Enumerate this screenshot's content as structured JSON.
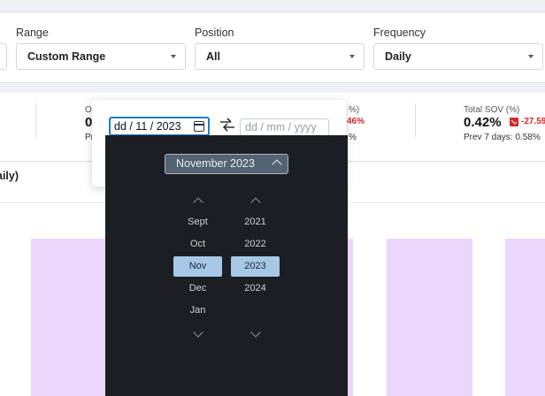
{
  "filters": {
    "range": {
      "label": "Range",
      "value": "Custom Range"
    },
    "position": {
      "label": "Position",
      "value": "All"
    },
    "frequency": {
      "label": "Frequency",
      "value": "Daily"
    }
  },
  "stats": {
    "partial_left": {
      "label_fragment": "O",
      "value_fragment": "0",
      "prev_fragment": "Pr"
    },
    "partial_mid": {
      "label_fragment": "%)",
      "delta_fragment": "46%",
      "prev_fragment": "%"
    },
    "total_sov": {
      "label": "Total SOV (%)",
      "value": "0.42%",
      "delta": "-27.59",
      "prev": "Prev 7 days: 0.58%"
    }
  },
  "chart": {
    "title_fragment": "aily)",
    "bar_color": "#ecd6fb"
  },
  "date_range": {
    "start_value": "dd / 11 / 2023",
    "end_placeholder": "dd / mm / yyyy"
  },
  "month_picker": {
    "header": "November 2023",
    "months": [
      "Sept",
      "Oct",
      "Nov",
      "Dec",
      "Jan"
    ],
    "years": [
      "2021",
      "2022",
      "2023",
      "2024"
    ],
    "selected_month": "Nov",
    "selected_year": "2023"
  },
  "colors": {
    "accent_blue": "#1f7fc2",
    "picker_bg": "#1b1f23",
    "selected_bg": "#a7c7e7",
    "negative_red": "#d12a2a"
  },
  "icons": {
    "calendar": "calendar-icon",
    "swap": "swap-arrows-icon",
    "dropdown": "chevron-down-icon"
  }
}
